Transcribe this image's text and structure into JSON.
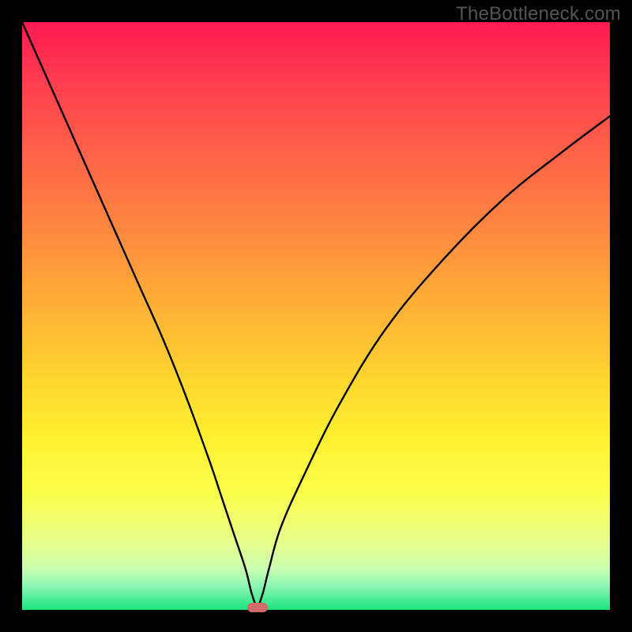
{
  "watermark": "TheBottleneck.com",
  "chart_data": {
    "type": "line",
    "title": "",
    "xlabel": "",
    "ylabel": "",
    "xlim": [
      0,
      100
    ],
    "ylim": [
      0,
      100
    ],
    "x": [
      0,
      4,
      8,
      12,
      16,
      20,
      24,
      28,
      32,
      34,
      36,
      38,
      39,
      40,
      41,
      42,
      44,
      48,
      54,
      62,
      72,
      82,
      92,
      100
    ],
    "y": [
      100,
      91,
      82,
      73,
      64,
      55,
      46,
      36,
      25,
      19,
      13,
      7,
      3,
      0,
      3,
      7,
      14,
      23,
      35,
      48,
      60,
      70,
      78,
      84
    ],
    "cusp_x": 40,
    "marker": {
      "x": 40,
      "y": 0
    },
    "background_gradient": {
      "top": "#ff1a52",
      "mid": "#ffd32f",
      "bottom": "#18e47c"
    },
    "colors": {
      "curve": "#000000",
      "marker": "#d26a6a",
      "frame_border": "#000000"
    }
  }
}
